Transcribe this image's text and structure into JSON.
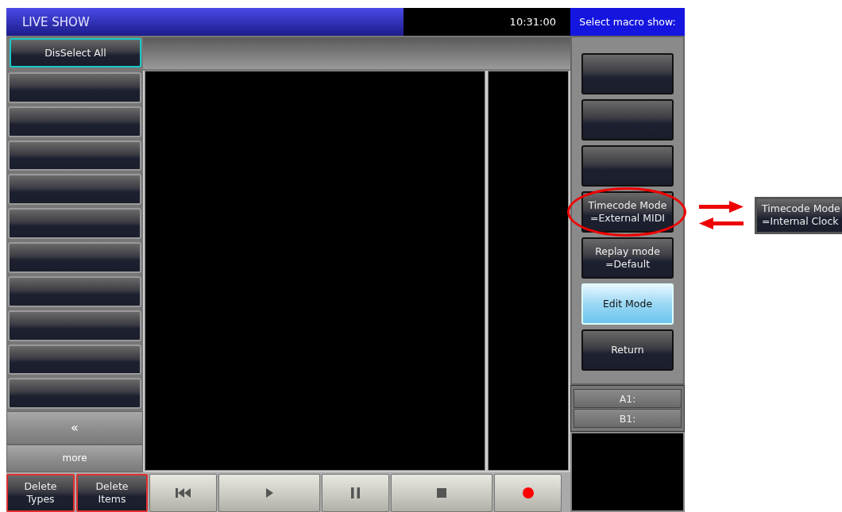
{
  "header": {
    "title": "LIVE SHOW",
    "clock": "10:31:00",
    "prompt": "Select macro show:"
  },
  "deselect_button": {
    "label": "DisSelect All",
    "selected": true
  },
  "left_buttons": [
    {
      "kind": "empty"
    },
    {
      "kind": "empty"
    },
    {
      "kind": "empty"
    },
    {
      "kind": "empty"
    },
    {
      "kind": "empty"
    },
    {
      "kind": "empty"
    },
    {
      "kind": "empty"
    },
    {
      "kind": "empty"
    },
    {
      "kind": "empty"
    },
    {
      "kind": "empty"
    }
  ],
  "page_back": {
    "label": "«"
  },
  "more_button": {
    "label": "more"
  },
  "bottom_buttons": [
    {
      "kind": "text",
      "label": "Delete\nTypes",
      "highlighted": true
    },
    {
      "kind": "text",
      "label": "Delete\nItems",
      "highlighted": true
    },
    {
      "kind": "rewind"
    },
    {
      "kind": "play"
    },
    {
      "kind": "pause"
    },
    {
      "kind": "stop"
    },
    {
      "kind": "record"
    }
  ],
  "macro_buttons": [
    {
      "selected": false
    },
    {
      "selected": false
    },
    {
      "selected": false
    },
    {
      "label": "Timecode Mode\n=External MIDI",
      "selected": false,
      "circled": true
    },
    {
      "label": "Replay mode\n=Default",
      "selected": false
    },
    {
      "label": "Edit Mode",
      "selected": true
    },
    {
      "label": "Return",
      "selected": false
    }
  ],
  "fields": [
    {
      "label": "A1:"
    },
    {
      "label": "B1:"
    }
  ],
  "callout": {
    "label": "Timecode Mode\n=Internal Clock"
  }
}
